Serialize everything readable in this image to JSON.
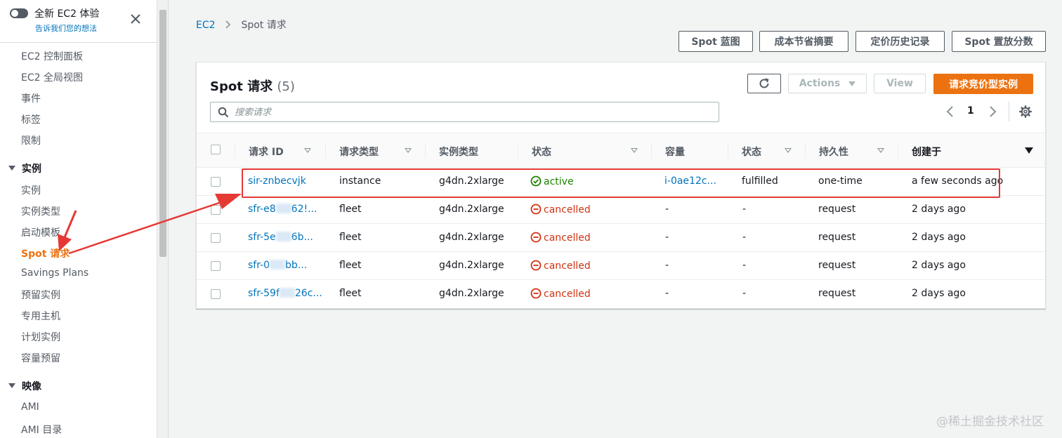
{
  "sidebar": {
    "toggle_title": "全新 EC2 体验",
    "toggle_link": "告诉我们您的想法",
    "items": [
      {
        "label": "EC2 控制面板"
      },
      {
        "label": "EC2 全局视图"
      },
      {
        "label": "事件"
      },
      {
        "label": "标签"
      },
      {
        "label": "限制"
      }
    ],
    "section_instances": "实例",
    "instance_items": [
      {
        "label": "实例"
      },
      {
        "label": "实例类型"
      },
      {
        "label": "启动模板"
      },
      {
        "label": "Spot 请求",
        "active": true
      },
      {
        "label": "Savings Plans"
      },
      {
        "label": "预留实例"
      },
      {
        "label": "专用主机"
      },
      {
        "label": "计划实例"
      },
      {
        "label": "容量预留"
      }
    ],
    "section_images": "映像",
    "image_items": [
      {
        "label": "AMI"
      },
      {
        "label": "AMI 目录"
      }
    ]
  },
  "breadcrumb": {
    "root": "EC2",
    "current": "Spot 请求"
  },
  "top_buttons": {
    "spot_blueprint": "Spot 蓝图",
    "savings_summary": "成本节省摘要",
    "pricing_history": "定价历史记录",
    "placement_score": "Spot 置放分数"
  },
  "panel": {
    "title": "Spot 请求",
    "count": "(5)",
    "actions_label": "Actions",
    "view_label": "View",
    "primary_label": "请求竞价型实例",
    "search_placeholder": "搜索请求",
    "page_number": "1"
  },
  "table": {
    "headers": [
      "请求 ID",
      "请求类型",
      "实例类型",
      "状态",
      "容量",
      "状态",
      "持久性",
      "创建于"
    ],
    "rows": [
      {
        "id": "sir-znbecvjk",
        "id_tail": "",
        "type": "instance",
        "instance_type": "g4dn.2xlarge",
        "state": "active",
        "capacity": "i-0ae12c...",
        "status": "fulfilled",
        "persistence": "one-time",
        "created": "a few seconds ago"
      },
      {
        "id": "sfr-e8",
        "id_tail": "62!...",
        "type": "fleet",
        "instance_type": "g4dn.2xlarge",
        "state": "cancelled",
        "capacity": "-",
        "status": "-",
        "persistence": "request",
        "created": "2 days ago"
      },
      {
        "id": "sfr-5e",
        "id_tail": "6b...",
        "type": "fleet",
        "instance_type": "g4dn.2xlarge",
        "state": "cancelled",
        "capacity": "-",
        "status": "-",
        "persistence": "request",
        "created": "2 days ago"
      },
      {
        "id": "sfr-0",
        "id_tail": "bb...",
        "type": "fleet",
        "instance_type": "g4dn.2xlarge",
        "state": "cancelled",
        "capacity": "-",
        "status": "-",
        "persistence": "request",
        "created": "2 days ago"
      },
      {
        "id": "sfr-59f",
        "id_tail": "26c...",
        "type": "fleet",
        "instance_type": "g4dn.2xlarge",
        "state": "cancelled",
        "capacity": "-",
        "status": "-",
        "persistence": "request",
        "created": "2 days ago"
      }
    ]
  },
  "colors": {
    "accent": "#ec7211",
    "link": "#0073bb",
    "success": "#1d8102",
    "error": "#d13212",
    "annotation": "#e53935"
  },
  "watermark": "@稀土掘金技术社区"
}
